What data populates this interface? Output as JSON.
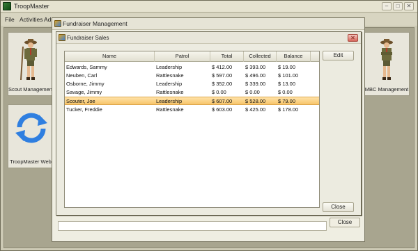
{
  "app": {
    "title": "TroopMaster",
    "menu": [
      "File",
      "Activities",
      "Ad"
    ],
    "controls": {
      "minimize": "–",
      "maximize": "□",
      "close": "✕"
    }
  },
  "tiles": [
    {
      "label": "Scout Management",
      "icon": "scout-figure-icon"
    },
    {
      "label": "TroopMaster Web",
      "icon": "sync-arrows-icon"
    },
    {
      "label": "MBC Management",
      "icon": "scout-figure-icon"
    }
  ],
  "fundraiser_management": {
    "title": "Fundraiser Management",
    "close_label": "Close"
  },
  "fundraiser_sales": {
    "title": "Fundraiser Sales",
    "close_icon": "✕",
    "columns": [
      "Name",
      "Patrol",
      "Total",
      "Collected",
      "Balance"
    ],
    "rows": [
      {
        "name": "Edwards, Sammy",
        "patrol": "Leadership",
        "total": "$ 412.00",
        "collected": "$ 393.00",
        "balance": "$ 19.00"
      },
      {
        "name": "Neuben, Carl",
        "patrol": "Rattlesnake",
        "total": "$ 597.00",
        "collected": "$ 496.00",
        "balance": "$ 101.00"
      },
      {
        "name": "Osborne, Jimmy",
        "patrol": "Leadership",
        "total": "$ 352.00",
        "collected": "$ 339.00",
        "balance": "$ 13.00"
      },
      {
        "name": "Savage, Jimmy",
        "patrol": "Rattlesnake",
        "total": "$ 0.00",
        "collected": "$ 0.00",
        "balance": "$ 0.00"
      },
      {
        "name": "Scouter, Joe",
        "patrol": "Leadership",
        "total": "$ 607.00",
        "collected": "$ 528.00",
        "balance": "$ 79.00"
      },
      {
        "name": "Tucker, Freddie",
        "patrol": "Rattlesnake",
        "total": "$ 603.00",
        "collected": "$ 425.00",
        "balance": "$ 178.00"
      }
    ],
    "selected_row": "Scouter, Joe",
    "edit_label": "Edit",
    "close_label": "Close"
  },
  "colors": {
    "selection": "#f7c56b",
    "window_bg": "#ecebe0",
    "desktop": "#a8a58f"
  }
}
